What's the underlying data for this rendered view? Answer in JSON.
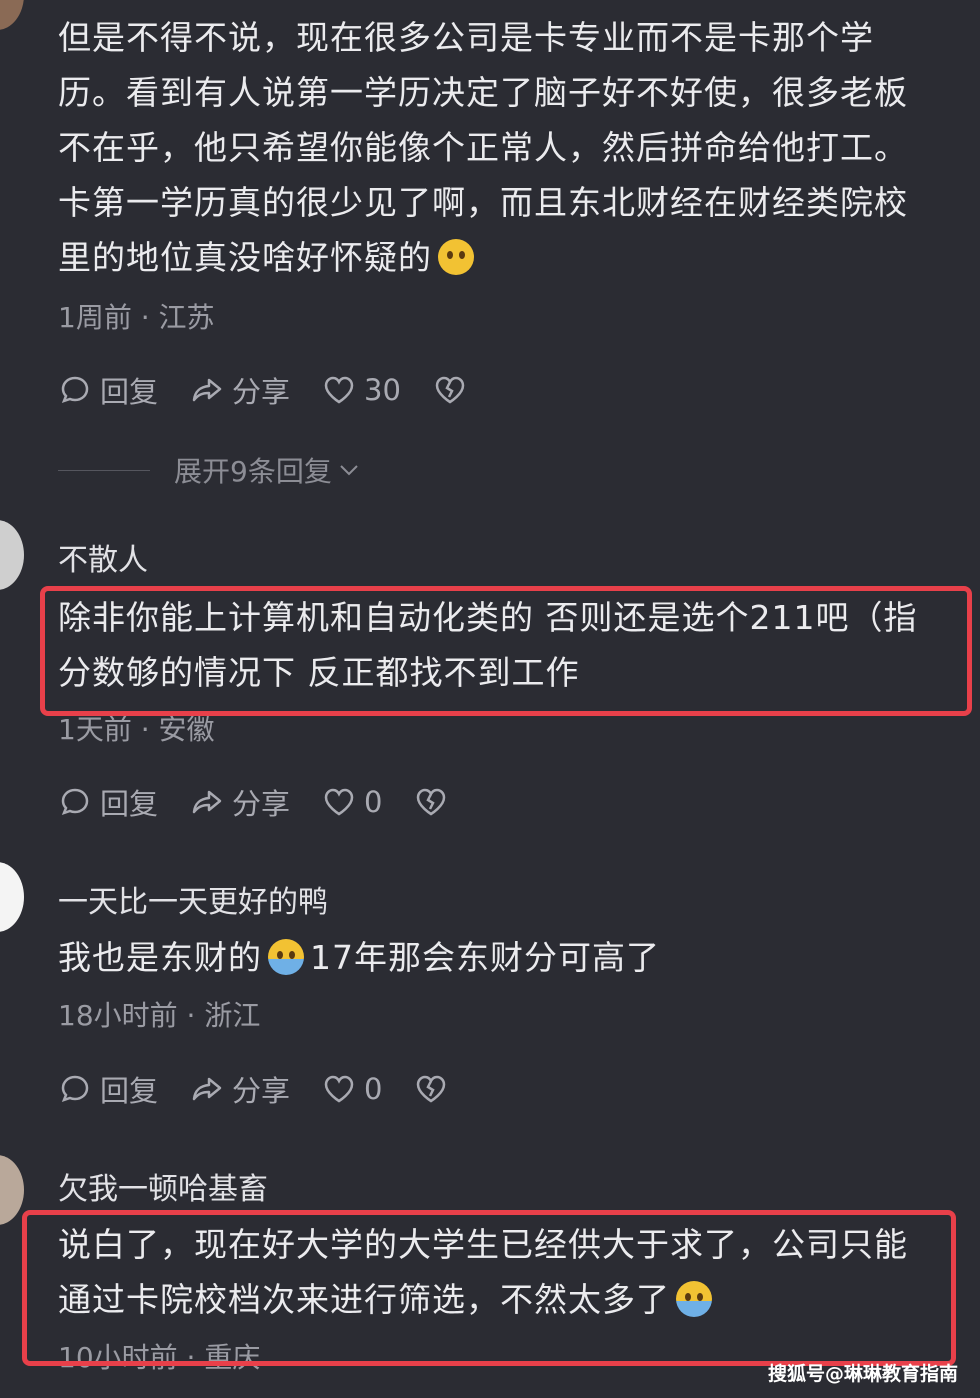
{
  "comments": [
    {
      "username": "",
      "text": "但是不得不说，现在很多公司是卡专业而不是卡那个学历。看到有人说第一学历决定了脑子好不好使，很多老板不在乎，他只希望你能像个正常人，然后拼命给他打工。卡第一学历真的很少见了啊，而且东北财经在财经类院校里的地位真没啥好怀疑的",
      "meta": "1周前 · 江苏",
      "reply": "回复",
      "share": "分享",
      "likes": "30",
      "expand": "展开9条回复"
    },
    {
      "username": "不散人",
      "text": "除非你能上计算机和自动化类的 否则还是选个211吧（指分数够的情况下 反正都找不到工作",
      "meta": "1天前 · 安徽",
      "reply": "回复",
      "share": "分享",
      "likes": "0"
    },
    {
      "username": "一天比一天更好的鸭",
      "text_a": "我也是东财的",
      "text_b": "17年那会东财分可高了",
      "meta": "18小时前 · 浙江",
      "reply": "回复",
      "share": "分享",
      "likes": "0"
    },
    {
      "username": "欠我一顿哈基畜",
      "text": "说白了，现在好大学的大学生已经供大于求了，公司只能通过卡院校档次来进行筛选，不然太多了",
      "meta": "10小时前 · 重庆"
    }
  ],
  "watermark": "搜狐号@琳琳教育指南",
  "colors": {
    "background": "#2b2c33",
    "highlight": "#e8404a",
    "text": "#ebebee",
    "muted": "#9a9ba3"
  },
  "icons": [
    "comment-icon",
    "share-icon",
    "heart-icon",
    "broken-heart-icon",
    "chevron-down-icon"
  ]
}
